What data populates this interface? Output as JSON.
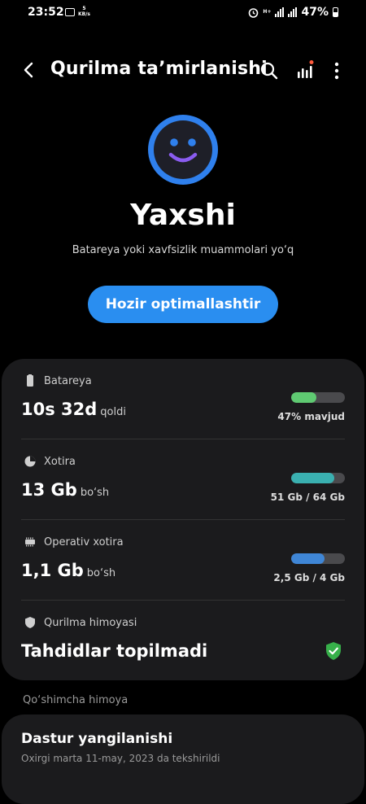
{
  "status_bar": {
    "time": "23:52",
    "speed_value": "5",
    "speed_unit": "KB/s",
    "network_label": "H+",
    "battery_percent": "47%"
  },
  "header": {
    "title": "Qurilma ta’mirlanishi"
  },
  "hero": {
    "status": "Yaxshi",
    "subtitle": "Batareya yoki xavfsizlik muammolari yo‘q",
    "optimize_button": "Hozir optimallashtir"
  },
  "sections": {
    "battery": {
      "label": "Batareya",
      "value": "10s 32d",
      "suffix": "qoldi",
      "caption": "47% mavjud",
      "fill": 0.47,
      "color": "#5fca72"
    },
    "storage": {
      "label": "Xotira",
      "value": "13 Gb",
      "suffix": "bo‘sh",
      "caption": "51 Gb / 64 Gb",
      "fill": 0.8,
      "color": "#3ab0b0"
    },
    "ram": {
      "label": "Operativ xotira",
      "value": "1,1 Gb",
      "suffix": "bo‘sh",
      "caption": "2,5 Gb / 4 Gb",
      "fill": 0.62,
      "color": "#3f86d6"
    },
    "protection": {
      "label": "Qurilma himoyasi",
      "value": "Tahdidlar topilmadi",
      "status_color": "#37b04a"
    }
  },
  "extra": {
    "label": "Qo‘shimcha himoya",
    "update_title": "Dastur yangilanishi",
    "update_subtitle": "Oxirgi marta 11-may, 2023 da tekshirildi"
  },
  "colors": {
    "accent": "#2a8ef0",
    "card_bg": "#1b1b1d",
    "notification_dot": "#ff5a3c"
  },
  "icons": [
    "back-arrow-icon",
    "search-icon",
    "chart-icon",
    "more-vert-icon",
    "smiley-face-icon",
    "battery-icon",
    "pie-chart-icon",
    "memory-chip-icon",
    "shield-icon",
    "shield-check-icon"
  ]
}
